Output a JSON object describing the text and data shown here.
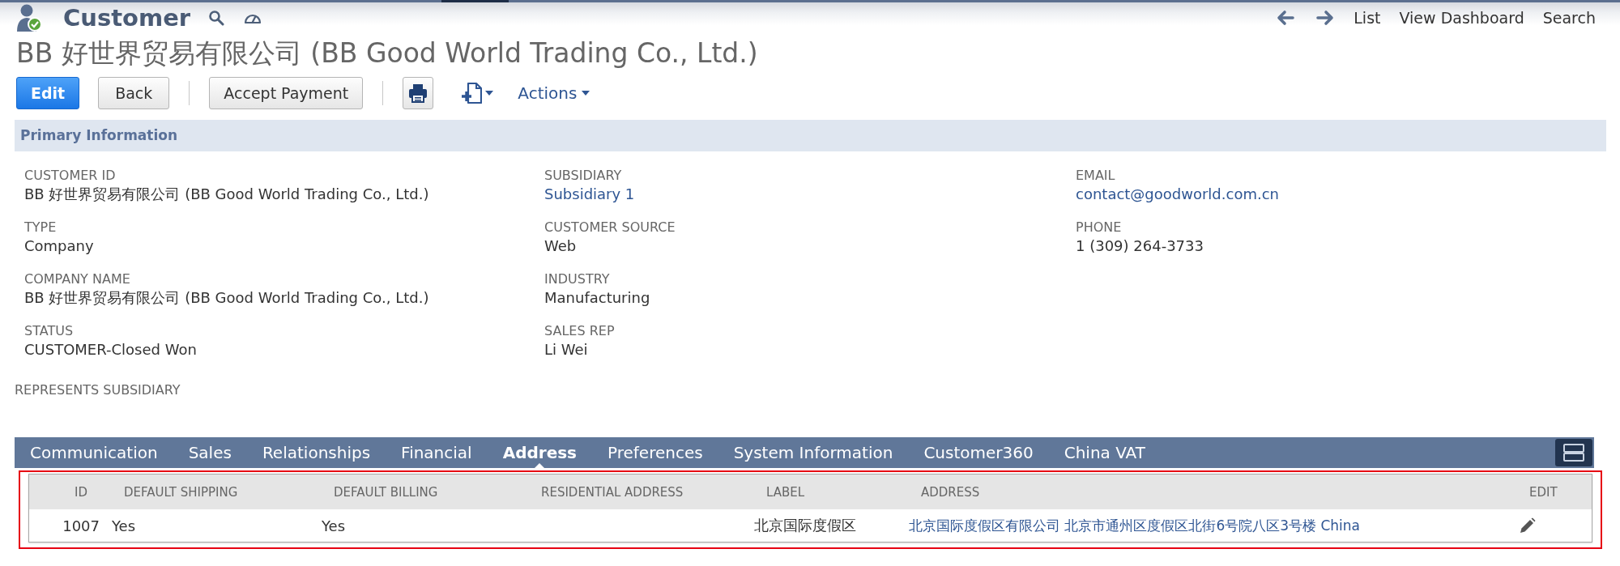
{
  "header": {
    "record_type": "Customer",
    "nav_links": [
      "List",
      "View Dashboard",
      "Search"
    ]
  },
  "title": "BB 好世界贸易有限公司 (BB Good World Trading Co., Ltd.)",
  "toolbar": {
    "edit": {
      "label": "Edit"
    },
    "back": {
      "label": "Back"
    },
    "accept_payment": {
      "label": "Accept Payment"
    },
    "actions": {
      "label": "Actions"
    }
  },
  "primary_information": {
    "title": "Primary Information",
    "columns": [
      [
        {
          "label": "CUSTOMER ID",
          "value": "BB 好世界贸易有限公司 (BB Good World Trading Co., Ltd.)",
          "link": false
        },
        {
          "label": "TYPE",
          "value": "Company",
          "link": false
        },
        {
          "label": "COMPANY NAME",
          "value": "BB 好世界贸易有限公司 (BB Good World Trading Co., Ltd.)",
          "link": false
        },
        {
          "label": "STATUS",
          "value": "CUSTOMER-Closed Won",
          "link": false
        }
      ],
      [
        {
          "label": "SUBSIDIARY",
          "value": "Subsidiary 1",
          "link": true
        },
        {
          "label": "CUSTOMER SOURCE",
          "value": "Web",
          "link": false
        },
        {
          "label": "INDUSTRY",
          "value": "Manufacturing",
          "link": false
        },
        {
          "label": "SALES REP",
          "value": "Li Wei",
          "link": false
        }
      ],
      [
        {
          "label": "EMAIL",
          "value": "contact@goodworld.com.cn",
          "link": true
        },
        {
          "label": "PHONE",
          "value": "1 (309) 264-3733",
          "link": false
        }
      ]
    ],
    "represents_subsidiary": {
      "label": "REPRESENTS SUBSIDIARY"
    }
  },
  "subtabs": [
    {
      "label": "Communication",
      "selected": false
    },
    {
      "label": "Sales",
      "selected": false
    },
    {
      "label": "Relationships",
      "selected": false
    },
    {
      "label": "Financial",
      "selected": false
    },
    {
      "label": "Address",
      "selected": true
    },
    {
      "label": "Preferences",
      "selected": false
    },
    {
      "label": "System Information",
      "selected": false
    },
    {
      "label": "Customer360",
      "selected": false
    },
    {
      "label": "China VAT",
      "selected": false
    }
  ],
  "address_table": {
    "columns": [
      "ID",
      "DEFAULT SHIPPING",
      "DEFAULT BILLING",
      "RESIDENTIAL ADDRESS",
      "LABEL",
      "ADDRESS",
      "EDIT"
    ],
    "rows": [
      {
        "id": "1007",
        "default_shipping": "Yes",
        "default_billing": "Yes",
        "label": "北京国际度假区",
        "address": "北京国际度假区有限公司 北京市通州区度假区北街6号院八区3号楼 China"
      }
    ]
  }
}
